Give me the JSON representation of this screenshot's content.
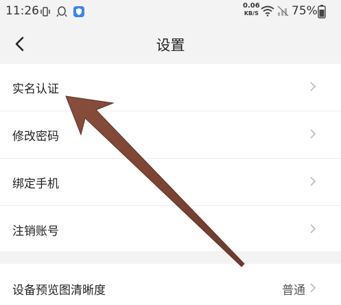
{
  "status_bar": {
    "time": "11:26",
    "net_speed_value": "0.06",
    "net_speed_unit": "KB/S",
    "battery": "75%"
  },
  "header": {
    "title": "设置"
  },
  "settings_group_1": [
    {
      "label": "实名认证"
    },
    {
      "label": "修改密码"
    },
    {
      "label": "绑定手机"
    },
    {
      "label": "注销账号"
    }
  ],
  "settings_group_2": [
    {
      "label": "设备预览图清晰度",
      "value": "普通"
    }
  ],
  "colors": {
    "background": "#f3f3f3",
    "row_background": "#ffffff",
    "annotation_arrow": "#7a4434"
  }
}
